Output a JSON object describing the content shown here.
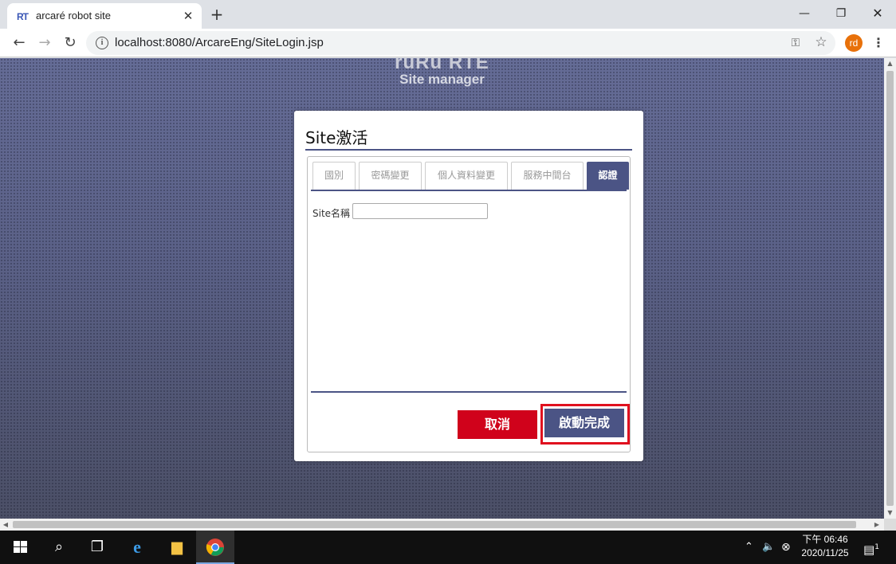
{
  "browser": {
    "tab_favicon": "RT",
    "tab_title": "arcaré robot site",
    "tab_close_icon": "✕",
    "new_tab_icon": "+",
    "url": "localhost:8080/ArcareEng/SiteLogin.jsp",
    "profile_initials": "rd",
    "window_minimize": "—",
    "window_restore": "❐",
    "window_close": "✕"
  },
  "page": {
    "brand_line1": "ruRu RTE",
    "brand_line2": "Site manager",
    "dialog": {
      "title": "Site激活",
      "tabs": [
        {
          "label": "國別",
          "active": false
        },
        {
          "label": "密碼變更",
          "active": false
        },
        {
          "label": "個人資料變更",
          "active": false
        },
        {
          "label": "服務中間台",
          "active": false
        },
        {
          "label": "認證",
          "active": true
        }
      ],
      "site_name_label": "Site名稱",
      "site_name_value": "",
      "cancel_label": "取消",
      "complete_label": "啟動完成"
    },
    "colors": {
      "accent": "#4b5485",
      "cancel": "#d0021b",
      "highlight": "#e0101e"
    }
  },
  "taskbar": {
    "clock_line1": "下午 06:46",
    "clock_line2": "2020/11/25",
    "notification_count": "1",
    "pinned": [
      "start-icon",
      "search-icon",
      "task-view-icon",
      "internet-explorer-icon",
      "file-explorer-icon",
      "chrome-icon"
    ]
  }
}
